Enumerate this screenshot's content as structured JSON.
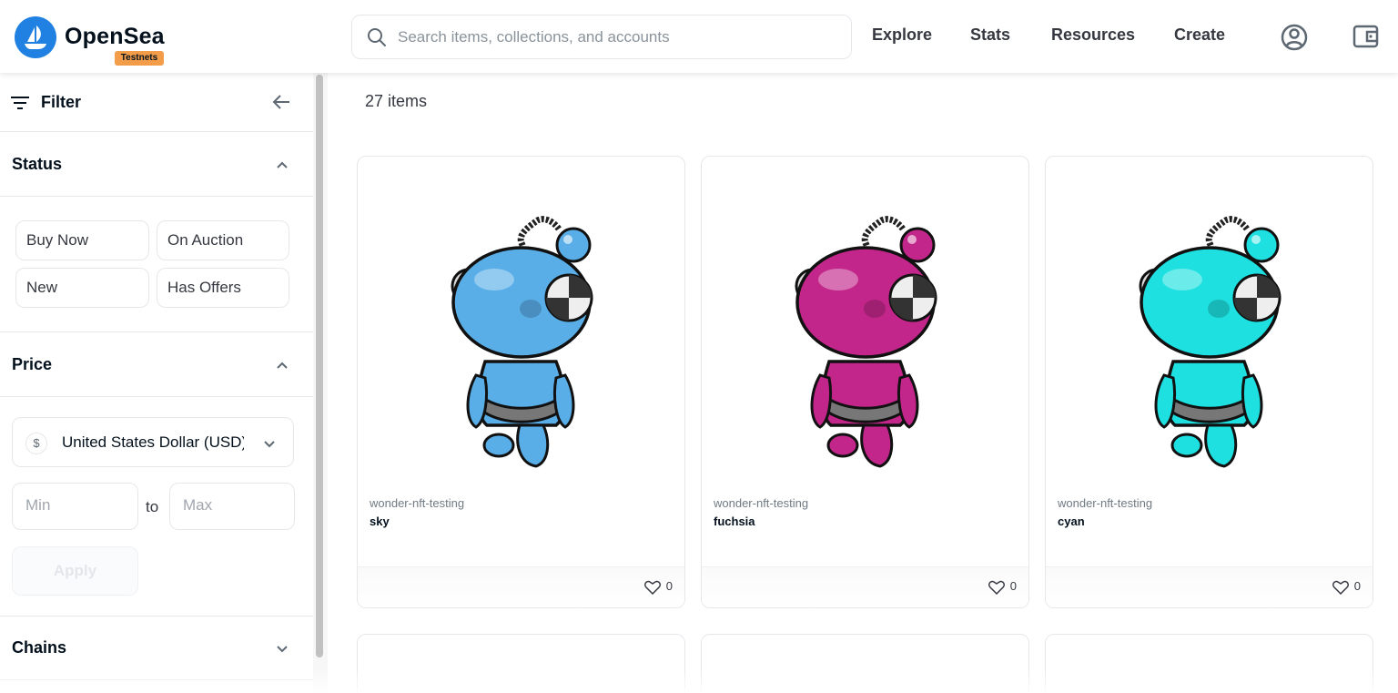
{
  "header": {
    "brand": "OpenSea",
    "badge": "Testnets",
    "search_placeholder": "Search items, collections, and accounts",
    "nav": [
      "Explore",
      "Stats",
      "Resources",
      "Create"
    ],
    "icons": [
      "profile-icon",
      "wallet-icon"
    ],
    "brand_color": "#2081e2",
    "badge_color": "#f39c4a"
  },
  "sidebar": {
    "filter_label": "Filter",
    "status": {
      "title": "Status",
      "options": [
        "Buy Now",
        "On Auction",
        "New",
        "Has Offers"
      ]
    },
    "price": {
      "title": "Price",
      "currency": "United States Dollar (USD)",
      "currency_symbol": "$",
      "min_placeholder": "Min",
      "max_placeholder": "Max",
      "to_label": "to",
      "apply_label": "Apply"
    },
    "chains": {
      "title": "Chains"
    }
  },
  "main": {
    "item_count": "27 items",
    "items": [
      {
        "collection": "wonder-nft-testing",
        "name": "sky",
        "likes": "0",
        "color": "#5aaee8"
      },
      {
        "collection": "wonder-nft-testing",
        "name": "fuchsia",
        "likes": "0",
        "color": "#c2268a"
      },
      {
        "collection": "wonder-nft-testing",
        "name": "cyan",
        "likes": "0",
        "color": "#1ee0e0"
      }
    ]
  }
}
